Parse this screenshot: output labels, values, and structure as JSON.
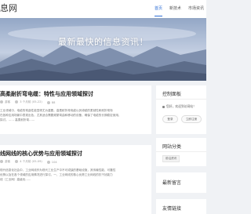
{
  "header": {
    "logo": "息网",
    "nav": [
      {
        "label": "首页",
        "active": true
      },
      {
        "label": "新技术",
        "active": false
      },
      {
        "label": "市场资讯",
        "active": false
      }
    ]
  },
  "hero": {
    "title": "最新最快的信息资讯！"
  },
  "articles": [
    {
      "title": "高柔耐折弯电缆：特性与应用领域探讨",
      "meta": [
        "游客",
        "3 个月前 (05-22)",
        "88"
      ],
      "excerpt": [
        "工业领域中，电缆的弯曲性能显得尤为重要。高柔耐折弯电缆以其卓越的柔韧性和耐折弯特",
        "在各种应用场景中表现出色，尤其适合需要频繁弯曲和移动的设备，确保了电缆的长期稳定使用，",
        "探讨。……  高柔耐折弯……"
      ]
    },
    {
      "title": "线网线的核心优势与应用领域探讨",
      "meta": [
        "游客",
        "4 个月前 (05-09)",
        "104"
      ],
      "excerpt": [
        "现代信息化社会中，工业网线作为现代工业生产中不可或缺的基础设施，其传输性能、可靠性",
        "优势以及在各个领域的应用情况进行探讨。一、工业网线的核心优势工业网线的抗干扰能力",
        "线（工业网）高级优……"
      ]
    }
  ],
  "sidebar": {
    "control_panel": {
      "title": "控制面板",
      "welcome": "您好，欢迎到访网站！",
      "buttons": [
        "登录",
        "立即注册"
      ]
    },
    "categories": {
      "title": "网站分类",
      "items": [
        "前沿资讯"
      ]
    },
    "latest": {
      "title": "最新留言"
    },
    "links": {
      "title": "友情链接"
    }
  }
}
